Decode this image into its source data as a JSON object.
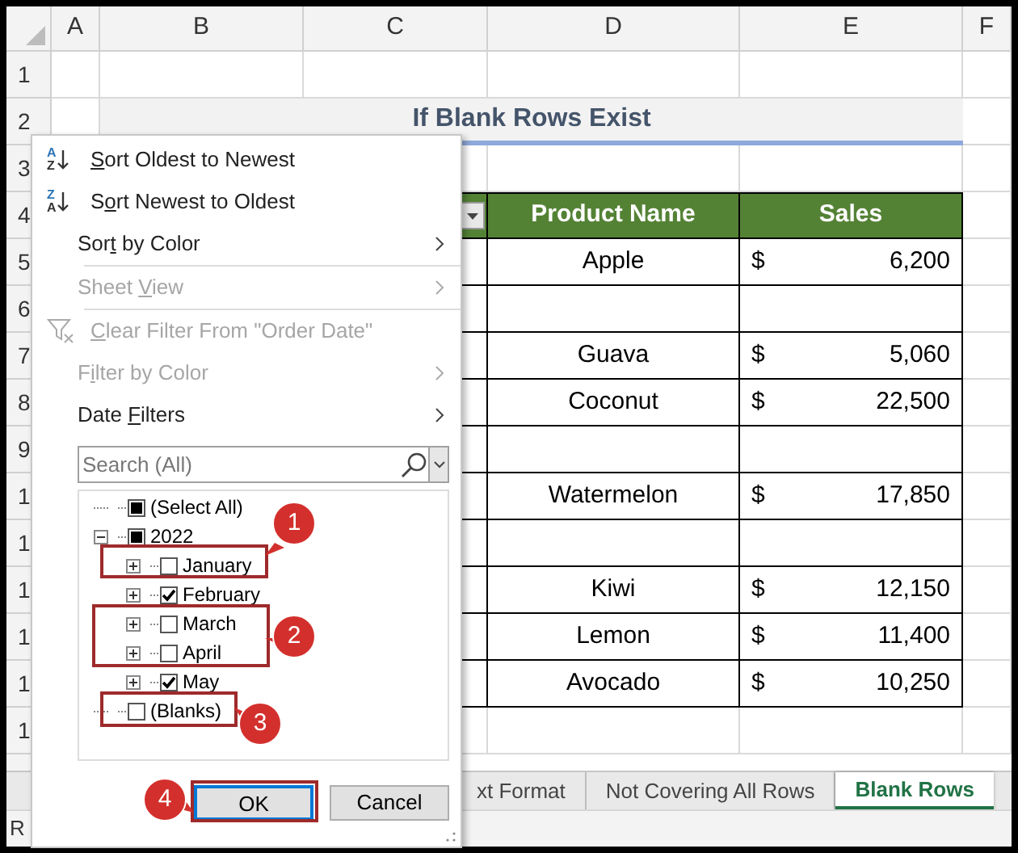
{
  "sheet": {
    "column_headers": [
      "A",
      "B",
      "C",
      "D",
      "E",
      "F"
    ],
    "row_headers": [
      "1",
      "2",
      "3",
      "4",
      "5",
      "6",
      "7",
      "8",
      "9",
      "1",
      "1",
      "1",
      "1",
      "1",
      "1"
    ],
    "title": "If Blank Rows Exist",
    "table": {
      "columns": [
        "Product Name",
        "Sales"
      ],
      "rows": [
        {
          "product": "Apple",
          "currency": "$",
          "amount": "6,200"
        },
        {},
        {
          "product": "Guava",
          "currency": "$",
          "amount": "5,060"
        },
        {
          "product": "Coconut",
          "currency": "$",
          "amount": "22,500"
        },
        {},
        {
          "product": "Watermelon",
          "currency": "$",
          "amount": "17,850"
        },
        {},
        {
          "product": "Kiwi",
          "currency": "$",
          "amount": "12,150"
        },
        {
          "product": "Lemon",
          "currency": "$",
          "amount": "11,400"
        },
        {
          "product": "Avocado",
          "currency": "$",
          "amount": "10,250"
        }
      ]
    }
  },
  "sheet_tabs": [
    {
      "label": "xt Format",
      "selected": false
    },
    {
      "label": "Not Covering All Rows",
      "selected": false
    },
    {
      "label": "Blank Rows",
      "selected": true
    }
  ],
  "status_bar": {
    "text": "R"
  },
  "filter_menu": {
    "items": [
      {
        "kind": "sort",
        "icon_letters": [
          "A",
          "Z"
        ],
        "key": "S",
        "post": "ort Oldest to Newest",
        "disabled": false,
        "submenu": false
      },
      {
        "kind": "sort",
        "icon_letters": [
          "Z",
          "A"
        ],
        "pre": "S",
        "key": "o",
        "post": "rt Newest to Oldest",
        "disabled": false,
        "submenu": false
      },
      {
        "kind": "plain",
        "pre": "Sor",
        "key": "t",
        "post": " by Color",
        "disabled": false,
        "submenu": true,
        "separator_after": true
      },
      {
        "kind": "plain",
        "pre": "Sheet ",
        "key": "V",
        "post": "iew",
        "disabled": true,
        "submenu": true,
        "separator_after": true
      },
      {
        "kind": "clear",
        "key": "C",
        "post": "lear Filter From \"Order Date\"",
        "disabled": true,
        "submenu": false
      },
      {
        "kind": "plain",
        "pre": "F",
        "key": "i",
        "post": "lter by Color",
        "disabled": true,
        "submenu": true
      },
      {
        "kind": "plain",
        "pre": "Date ",
        "key": "F",
        "post": "ilters",
        "disabled": false,
        "submenu": true
      }
    ],
    "search": {
      "placeholder": "Search (All)"
    },
    "tree": [
      {
        "label": "(Select All)",
        "checked": false,
        "indeterminate": true
      },
      {
        "label": "2022",
        "checked": false,
        "indeterminate": true,
        "expanded": true,
        "children": [
          {
            "label": "January",
            "checked": false,
            "indeterminate": false,
            "expanded": false
          },
          {
            "label": "February",
            "checked": true,
            "indeterminate": false,
            "expanded": false
          },
          {
            "label": "March",
            "checked": false,
            "indeterminate": false,
            "expanded": false
          },
          {
            "label": "April",
            "checked": false,
            "indeterminate": false,
            "expanded": false
          },
          {
            "label": "May",
            "checked": true,
            "indeterminate": false,
            "expanded": false
          }
        ]
      },
      {
        "label": "(Blanks)",
        "checked": false,
        "indeterminate": false
      }
    ],
    "buttons": [
      {
        "label": "OK",
        "default": true
      },
      {
        "label": "Cancel",
        "default": false
      }
    ]
  },
  "callouts": [
    {
      "label": "1"
    },
    {
      "label": "2"
    },
    {
      "label": "3"
    },
    {
      "label": "4"
    }
  ]
}
